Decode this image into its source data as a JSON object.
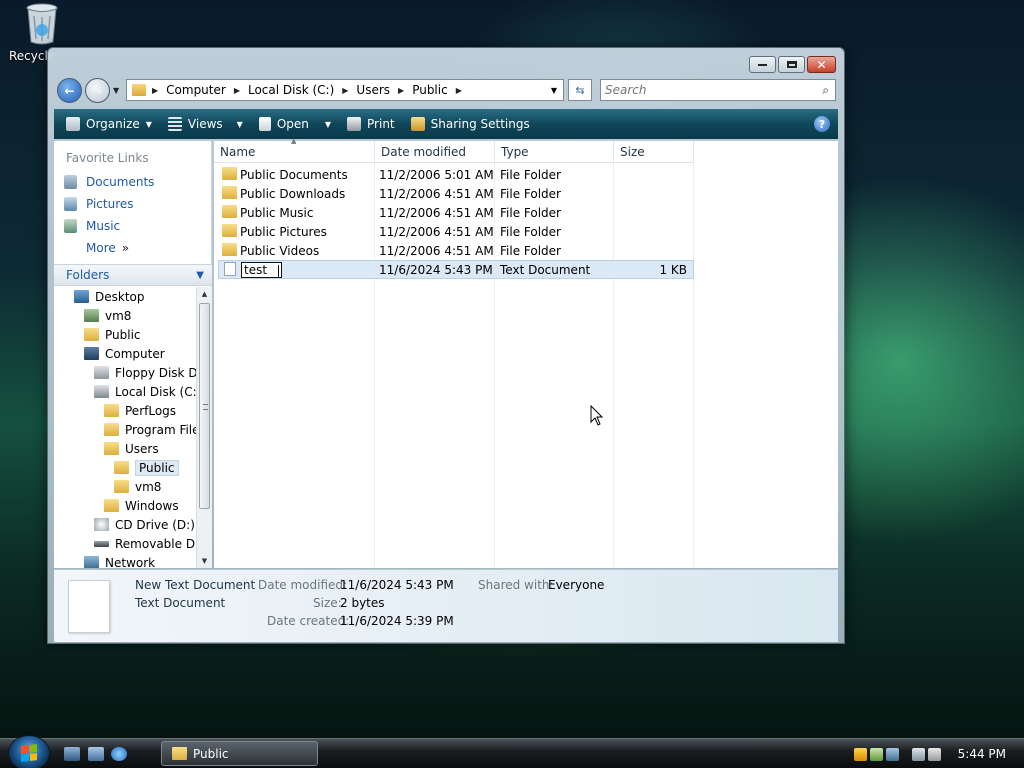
{
  "desktop": {
    "recycle_label": "Recycle"
  },
  "window": {
    "address": {
      "crumbs": [
        "Computer",
        "Local Disk (C:)",
        "Users",
        "Public"
      ]
    },
    "search": {
      "placeholder": "Search"
    },
    "toolbar": {
      "organize": "Organize",
      "views": "Views",
      "open": "Open",
      "print": "Print",
      "sharing": "Sharing Settings"
    },
    "nav": {
      "favorite_title": "Favorite Links",
      "favorites": [
        "Documents",
        "Pictures",
        "Music",
        "More"
      ],
      "folders_label": "Folders",
      "tree": [
        "Desktop",
        "vm8",
        "Public",
        "Computer",
        "Floppy Disk Dr",
        "Local Disk (C:)",
        "PerfLogs",
        "Program File",
        "Users",
        "Public",
        "vm8",
        "Windows",
        "CD Drive (D:)",
        "Removable Dis",
        "Network"
      ]
    },
    "columns": {
      "name": "Name",
      "date": "Date modified",
      "type": "Type",
      "size": "Size"
    },
    "files": [
      {
        "name": "Public Documents",
        "date": "11/2/2006 5:01 AM",
        "type": "File Folder",
        "size": ""
      },
      {
        "name": "Public Downloads",
        "date": "11/2/2006 4:51 AM",
        "type": "File Folder",
        "size": ""
      },
      {
        "name": "Public Music",
        "date": "11/2/2006 4:51 AM",
        "type": "File Folder",
        "size": ""
      },
      {
        "name": "Public Pictures",
        "date": "11/2/2006 4:51 AM",
        "type": "File Folder",
        "size": ""
      },
      {
        "name": "Public Videos",
        "date": "11/2/2006 4:51 AM",
        "type": "File Folder",
        "size": ""
      },
      {
        "name": "test",
        "date": "11/6/2024 5:43 PM",
        "type": "Text Document",
        "size": "1 KB"
      }
    ],
    "details": {
      "filename": "New Text Document",
      "filetype": "Text Document",
      "modified_label": "Date modified:",
      "modified": "11/6/2024 5:43 PM",
      "size_label": "Size:",
      "size": "2 bytes",
      "created_label": "Date created:",
      "created": "11/6/2024 5:39 PM",
      "shared_label": "Shared with:",
      "shared": "Everyone"
    }
  },
  "taskbar": {
    "window_button": "Public",
    "clock": "5:44 PM"
  }
}
